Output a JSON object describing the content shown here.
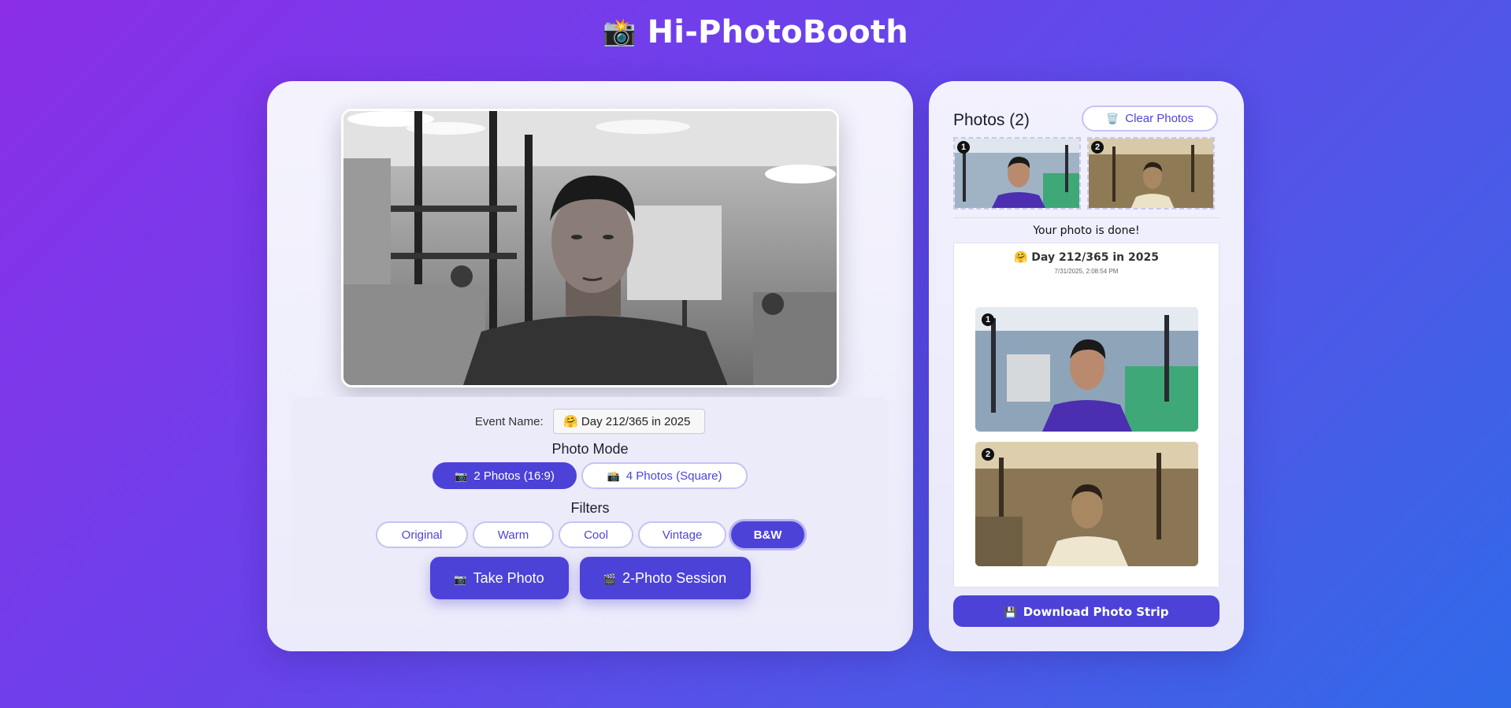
{
  "app": {
    "title": "Hi-PhotoBooth",
    "title_icon": "📸"
  },
  "event": {
    "label": "Event Name:",
    "value": "🤗 Day 212/365 in 2025"
  },
  "photo_mode": {
    "title": "Photo Mode",
    "options": [
      {
        "icon": "📷",
        "label": "2 Photos (16:9)",
        "active": true
      },
      {
        "icon": "📸",
        "label": "4 Photos (Square)",
        "active": false
      }
    ]
  },
  "filters": {
    "title": "Filters",
    "options": [
      "Original",
      "Warm",
      "Cool",
      "Vintage",
      "B&W"
    ],
    "active": "B&W"
  },
  "actions": {
    "take_photo": {
      "icon": "📷",
      "label": "Take Photo"
    },
    "session": {
      "icon": "🎬",
      "label": "2-Photo Session"
    }
  },
  "photos_panel": {
    "title": "Photos (2)",
    "clear": {
      "icon": "🗑️",
      "label": "Clear Photos"
    },
    "thumbnails": [
      {
        "num": "1"
      },
      {
        "num": "2"
      }
    ],
    "done_text": "Your photo is done!",
    "strip": {
      "title": "🤗 Day 212/365 in 2025",
      "date": "7/31/2025, 2:08:54 PM",
      "photos": [
        {
          "num": "1"
        },
        {
          "num": "2"
        }
      ]
    },
    "download": {
      "icon": "💾",
      "label": "Download Photo Strip"
    }
  },
  "colors": {
    "accent": "#4c42d8",
    "accent_border": "#c5c3f3"
  }
}
